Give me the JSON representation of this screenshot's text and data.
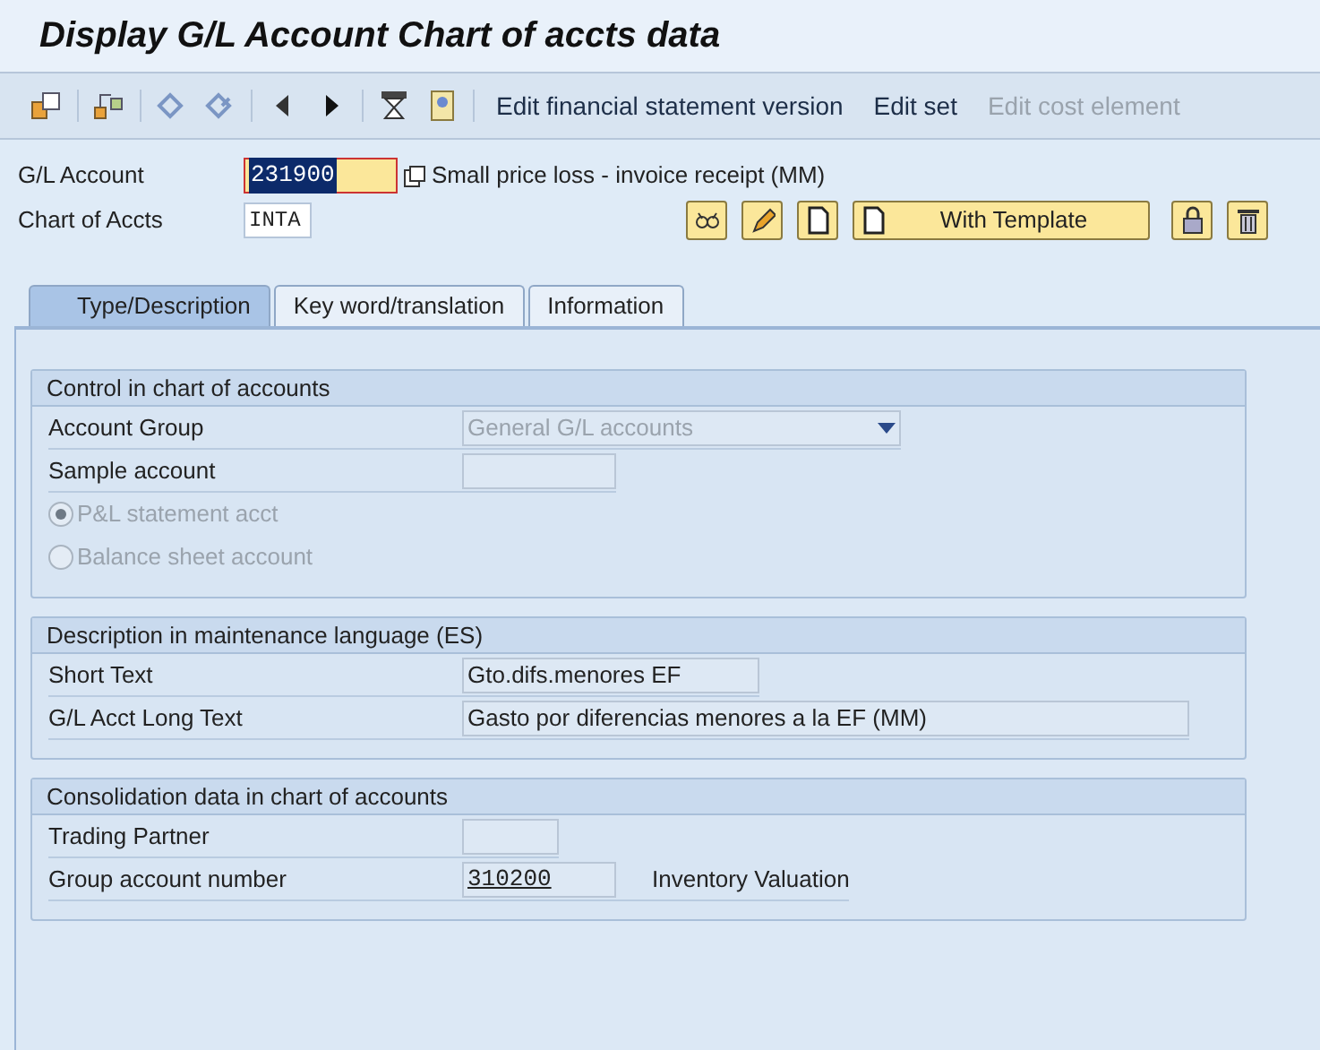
{
  "window": {
    "title": "Display G/L Account Chart of accts data"
  },
  "toolbar": {
    "icons": [
      {
        "kind": "other-object"
      },
      {
        "kind": "hierarchy"
      },
      {
        "kind": "undo"
      },
      {
        "kind": "redo"
      },
      {
        "kind": "prev"
      },
      {
        "kind": "next"
      },
      {
        "kind": "hourglass"
      },
      {
        "kind": "document"
      }
    ],
    "actions": [
      {
        "label": "Edit financial statement version",
        "disabled": false
      },
      {
        "label": "Edit set",
        "disabled": false
      },
      {
        "label": "Edit cost element",
        "disabled": true
      }
    ]
  },
  "header": {
    "account": {
      "label": "G/L Account",
      "value": "231900",
      "selected": true,
      "description": "Small price loss - invoice receipt (MM)"
    },
    "chart": {
      "label": "Chart of Accts",
      "value": "INTA"
    },
    "buttons": [
      {
        "kind": "glasses"
      },
      {
        "kind": "pencil"
      },
      {
        "kind": "new"
      },
      {
        "kind": "template",
        "label": "With Template"
      },
      {
        "kind": "lock"
      },
      {
        "kind": "delete"
      }
    ]
  },
  "tabs": [
    {
      "label": "Type/Description",
      "selected": true
    },
    {
      "label": "Key word/translation",
      "selected": false
    },
    {
      "label": "Information",
      "selected": false
    }
  ],
  "sections": [
    {
      "title": "Control in chart of accounts",
      "rows": [
        {
          "kind": "dropdown",
          "label": "Account Group",
          "value": "General G/L accounts",
          "disabled": true
        },
        {
          "kind": "field",
          "label": "Sample account",
          "disabled": true
        },
        {
          "kind": "radio",
          "label": "P&L statement acct",
          "selected": true,
          "disabled": true
        },
        {
          "kind": "radio",
          "label": "Balance sheet account",
          "selected": false,
          "disabled": true
        }
      ]
    },
    {
      "title": "Description in maintenance language (ES)",
      "rows": [
        {
          "kind": "field",
          "label": "Short Text",
          "value": "Gto.difs.menores EF",
          "disabled": true
        },
        {
          "kind": "field",
          "label": "G/L Acct Long Text",
          "value": "Gasto por diferencias menores a la EF (MM)",
          "disabled": true
        }
      ]
    },
    {
      "title": "Consolidation data in chart of accounts",
      "rows": [
        {
          "kind": "field",
          "label": "Trading Partner",
          "disabled": true
        },
        {
          "kind": "code",
          "label": "Group account number",
          "value": "310200",
          "disabled": true,
          "note": "Inventory Valuation"
        }
      ]
    }
  ]
}
